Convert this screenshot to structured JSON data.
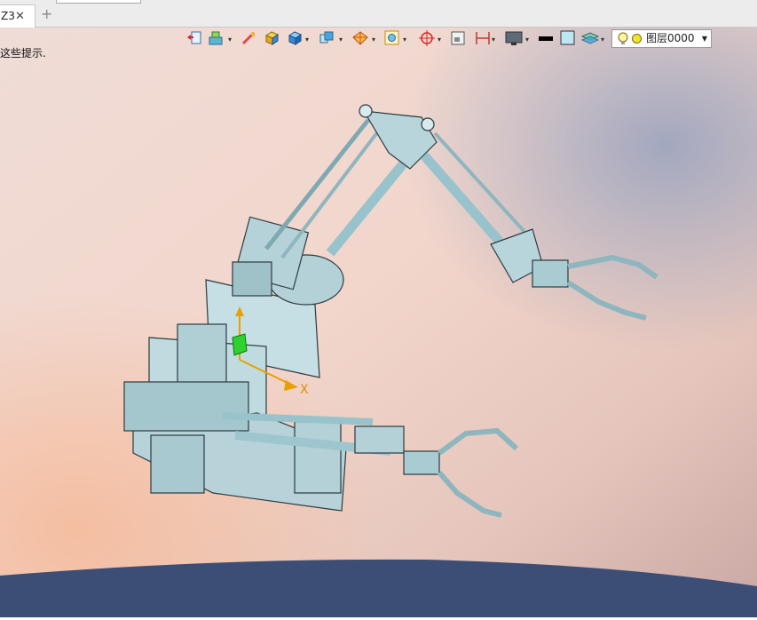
{
  "tab": {
    "label": "Z3",
    "close_glyph": "✕",
    "new_glyph": "+"
  },
  "hint": "这些提示.",
  "toolbar": {
    "icons": [
      "view-orient-icon",
      "render-mode-icon",
      "edge-display-icon",
      "shaded-cube-icon",
      "solid-cube-icon",
      "iso-view-icon",
      "section-view-icon",
      "fit-view-icon",
      "snap-point-icon",
      "sheet-icon",
      "dimension-icon",
      "display-monitor-icon",
      "line-color-icon",
      "fill-color-icon",
      "layer-stack-icon"
    ]
  },
  "layer": {
    "name": "图层0000",
    "color": "#f1e332"
  },
  "viewport": {
    "axis_x_label": "X",
    "background_top": "#f2d8d2",
    "background_bottom": "#3f5178"
  }
}
